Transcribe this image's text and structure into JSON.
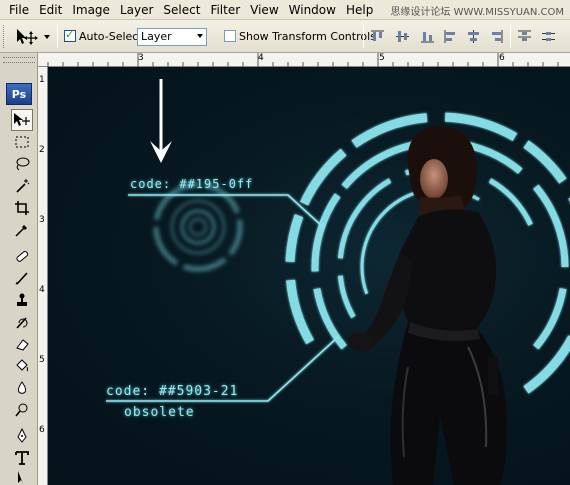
{
  "menubar": {
    "items": [
      "File",
      "Edit",
      "Image",
      "Layer",
      "Select",
      "Filter",
      "View",
      "Window",
      "Help"
    ],
    "watermark": "思缘设计论坛 WWW.MISSYUAN.COM"
  },
  "options_bar": {
    "auto_select_label": "Auto-Select:",
    "auto_select_checked": true,
    "auto_select_value": "Layer",
    "show_transform_label": "Show Transform Controls",
    "show_transform_checked": false
  },
  "app": {
    "logo": "Ps"
  },
  "ruler": {
    "top_numbers": [
      "3",
      "4",
      "5",
      "6"
    ],
    "left_numbers": [
      "1",
      "2",
      "3",
      "4",
      "5",
      "6"
    ]
  },
  "canvas": {
    "label_top": "code: ##195-0ff",
    "label_bottom": "code: ##5903-21",
    "label_bottom_sub": "obsolete"
  },
  "colors": {
    "hud_cyan": "#8ce6ef",
    "canvas_bg": "#06151d",
    "menu_bg": "#ece9d8"
  },
  "icons": [
    "move-tool-icon",
    "marquee-tool-icon",
    "lasso-tool-icon",
    "magic-wand-icon",
    "crop-tool-icon",
    "eyedropper-icon",
    "healing-brush-icon",
    "brush-icon",
    "clone-stamp-icon",
    "history-brush-icon",
    "eraser-icon",
    "paint-bucket-icon",
    "blur-tool-icon",
    "dodge-tool-icon",
    "pen-tool-icon",
    "type-tool-icon",
    "path-select-icon"
  ]
}
